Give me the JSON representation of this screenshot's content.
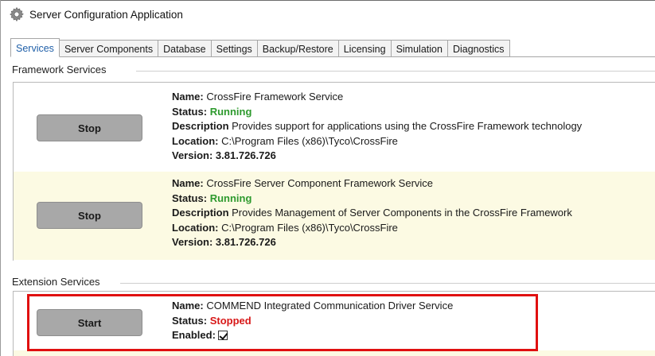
{
  "window": {
    "title": "Server Configuration Application",
    "icon": "gear-icon"
  },
  "tabs": [
    {
      "label": "Services",
      "active": true
    },
    {
      "label": "Server Components",
      "active": false
    },
    {
      "label": "Database",
      "active": false
    },
    {
      "label": "Settings",
      "active": false
    },
    {
      "label": "Backup/Restore",
      "active": false
    },
    {
      "label": "Licensing",
      "active": false
    },
    {
      "label": "Simulation",
      "active": false
    },
    {
      "label": "Diagnostics",
      "active": false
    }
  ],
  "labels": {
    "name": "Name:",
    "status": "Status:",
    "description": "Description",
    "location": "Location:",
    "version": "Version:",
    "enabled": "Enabled:"
  },
  "framework": {
    "header": "Framework Services",
    "services": [
      {
        "button": "Stop",
        "name": "CrossFire Framework Service",
        "status": "Running",
        "description": "Provides support for applications using the CrossFire Framework technology",
        "location": "C:\\Program Files (x86)\\Tyco\\CrossFire",
        "version": "3.81.726.726"
      },
      {
        "button": "Stop",
        "name": "CrossFire Server Component Framework Service",
        "status": "Running",
        "description": "Provides Management of Server Components in the CrossFire Framework",
        "location": "C:\\Program Files (x86)\\Tyco\\CrossFire",
        "version": "3.81.726.726"
      }
    ]
  },
  "extension": {
    "header": "Extension Services",
    "services": [
      {
        "button": "Start",
        "name": "COMMEND Integrated Communication Driver Service",
        "status": "Stopped",
        "enabled": true
      }
    ]
  },
  "colors": {
    "status_running": "#2e9a2e",
    "status_stopped": "#d81818",
    "highlight": "#e01010",
    "row_alt": "#fcfae3"
  }
}
